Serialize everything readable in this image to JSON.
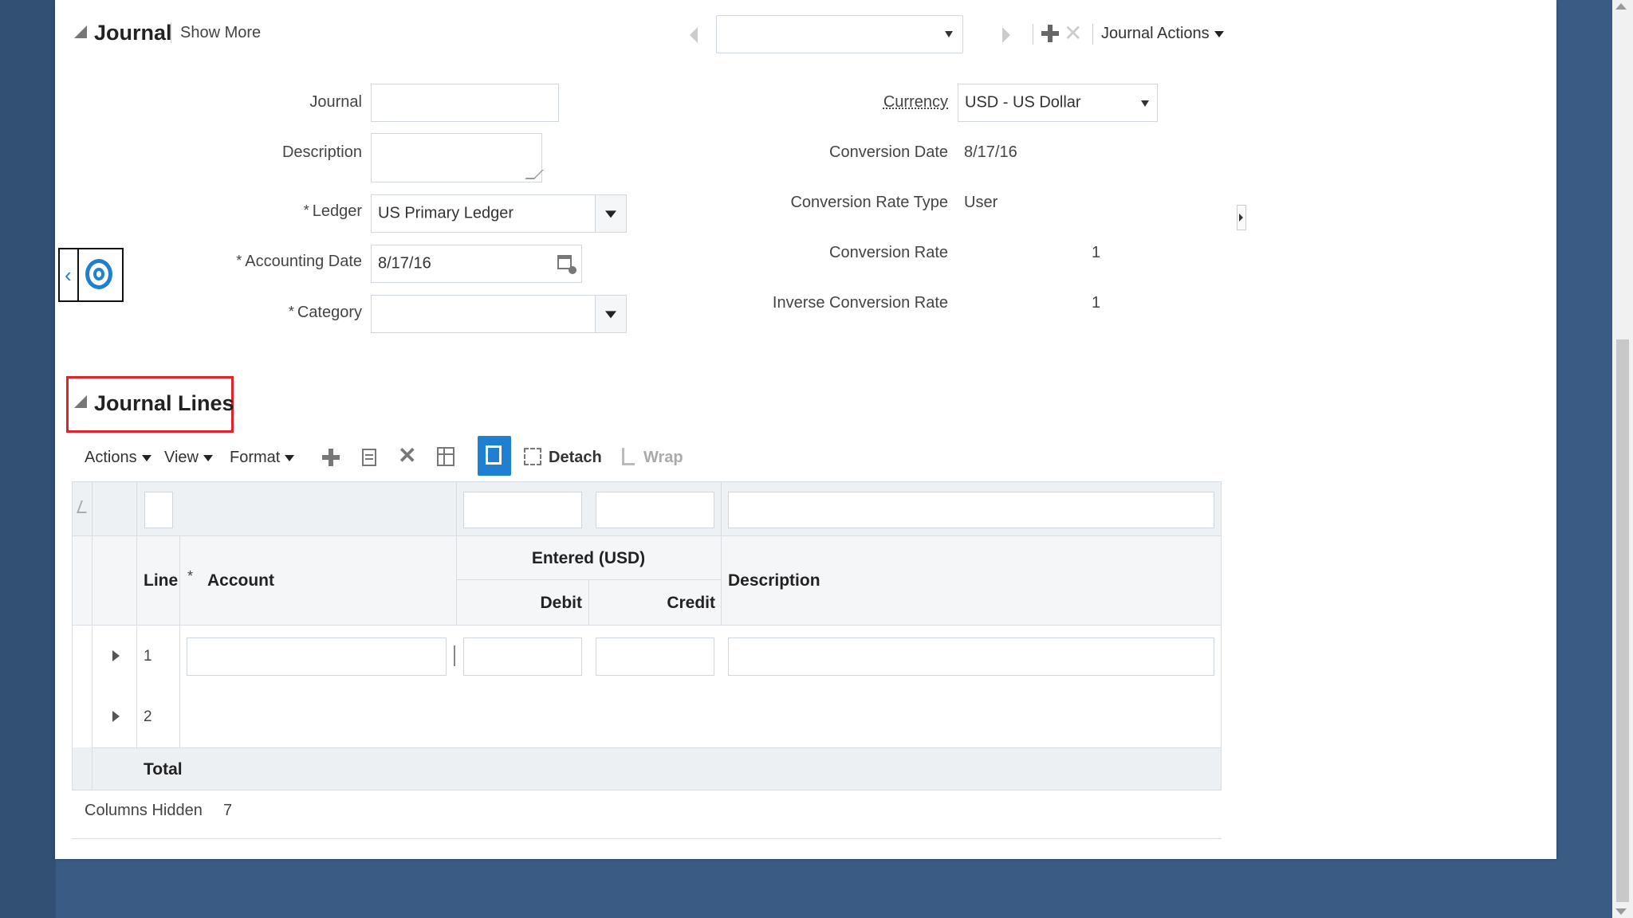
{
  "header": {
    "title": "Journal",
    "show_more": "Show More",
    "journal_actions": "Journal Actions"
  },
  "form": {
    "journal_label": "Journal",
    "description_label": "Description",
    "ledger_label": "Ledger",
    "ledger_value": "US Primary Ledger",
    "accounting_date_label": "Accounting Date",
    "accounting_date_value": "8/17/16",
    "category_label": "Category",
    "required_mark": "*",
    "currency_label": "Currency",
    "currency_value": "USD - US Dollar",
    "conversion_date_label": "Conversion Date",
    "conversion_date_value": "8/17/16",
    "conversion_rate_type_label": "Conversion Rate Type",
    "conversion_rate_type_value": "User",
    "conversion_rate_label": "Conversion Rate",
    "conversion_rate_value": "1",
    "inverse_conversion_rate_label": "Inverse Conversion Rate",
    "inverse_conversion_rate_value": "1"
  },
  "lines": {
    "title": "Journal Lines",
    "toolbar": {
      "actions": "Actions",
      "view": "View",
      "format": "Format",
      "detach": "Detach",
      "wrap": "Wrap"
    },
    "columns": {
      "line": "Line",
      "account": "Account",
      "entered": "Entered (USD)",
      "debit": "Debit",
      "credit": "Credit",
      "description": "Description"
    },
    "rows": [
      {
        "line": "1"
      },
      {
        "line": "2"
      }
    ],
    "total_label": "Total",
    "columns_hidden_label": "Columns Hidden",
    "columns_hidden_value": "7"
  },
  "colors": {
    "background": "#3a5c84",
    "highlight": "#e32128",
    "accent": "#1f7fd1"
  }
}
